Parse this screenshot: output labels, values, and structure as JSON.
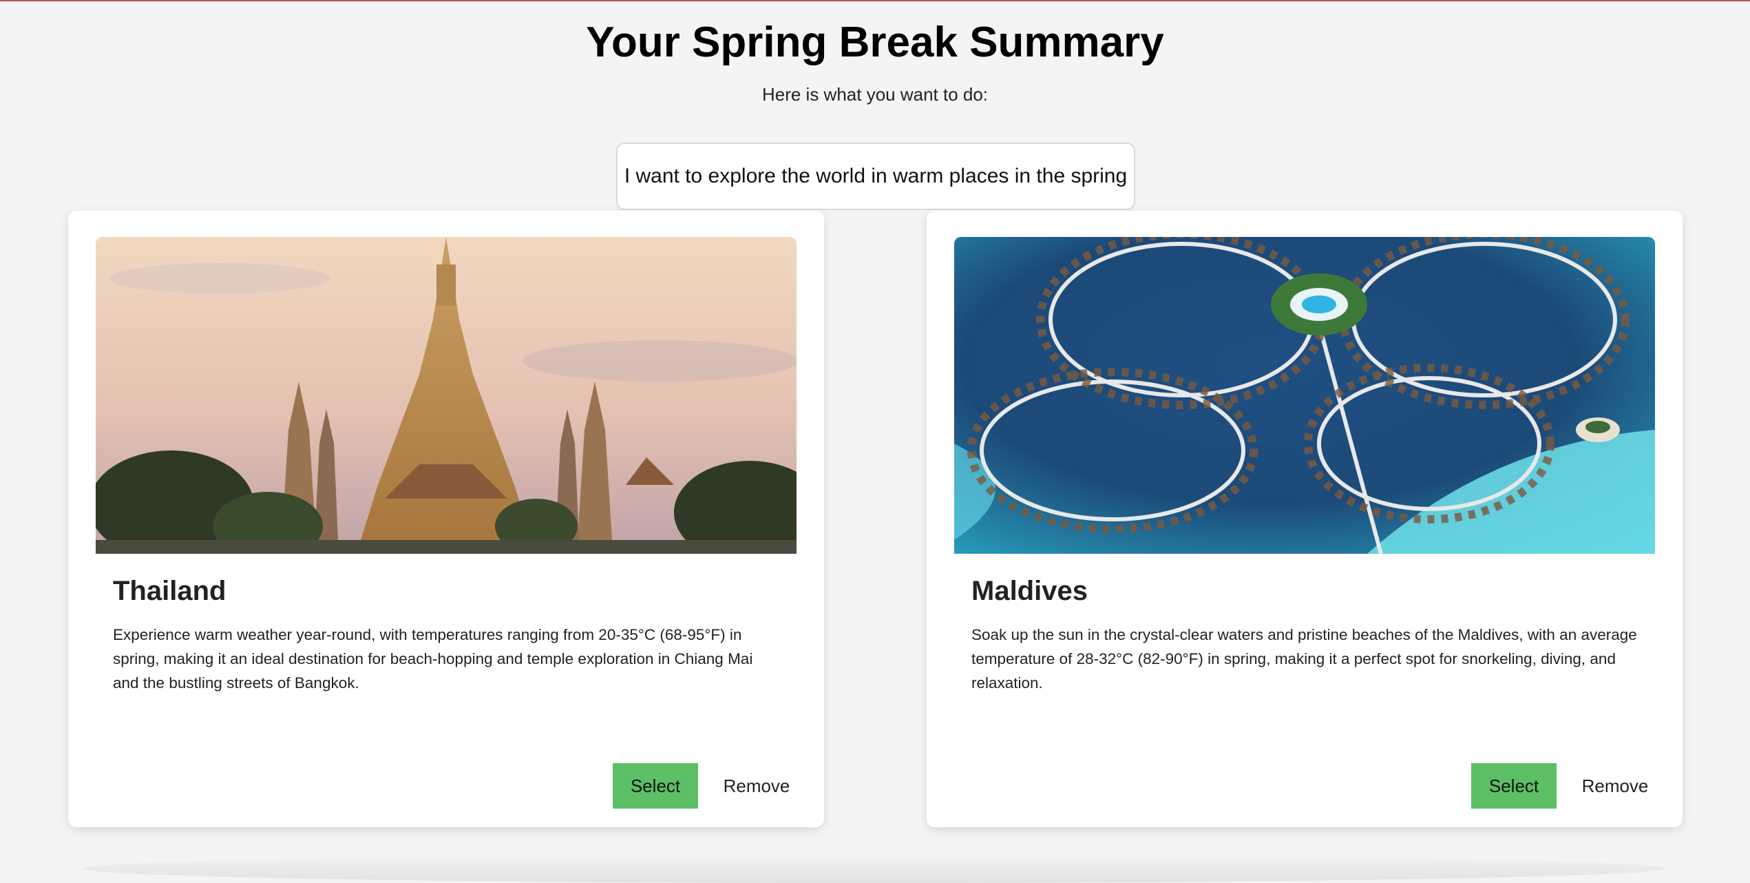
{
  "page": {
    "title": "Your Spring Break Summary",
    "subtitle": "Here is what you want to do:",
    "prompt": "I want to explore the world in warm places in the spring"
  },
  "cards": [
    {
      "name": "Thailand",
      "description": "Experience warm weather year-round, with temperatures ranging from 20-35°C (68-95°F) in spring, making it an ideal destination for beach-hopping and temple exploration in Chiang Mai and the bustling streets of Bangkok.",
      "select_label": "Select",
      "remove_label": "Remove"
    },
    {
      "name": "Maldives",
      "description": "Soak up the sun in the crystal-clear waters and pristine beaches of the Maldives, with an average temperature of 28-32°C (82-90°F) in spring, making it a perfect spot for snorkeling, diving, and relaxation.",
      "select_label": "Select",
      "remove_label": "Remove"
    }
  ],
  "colors": {
    "background": "#f3f4f6",
    "select_button": "#5cbf66",
    "card": "#ffffff"
  }
}
